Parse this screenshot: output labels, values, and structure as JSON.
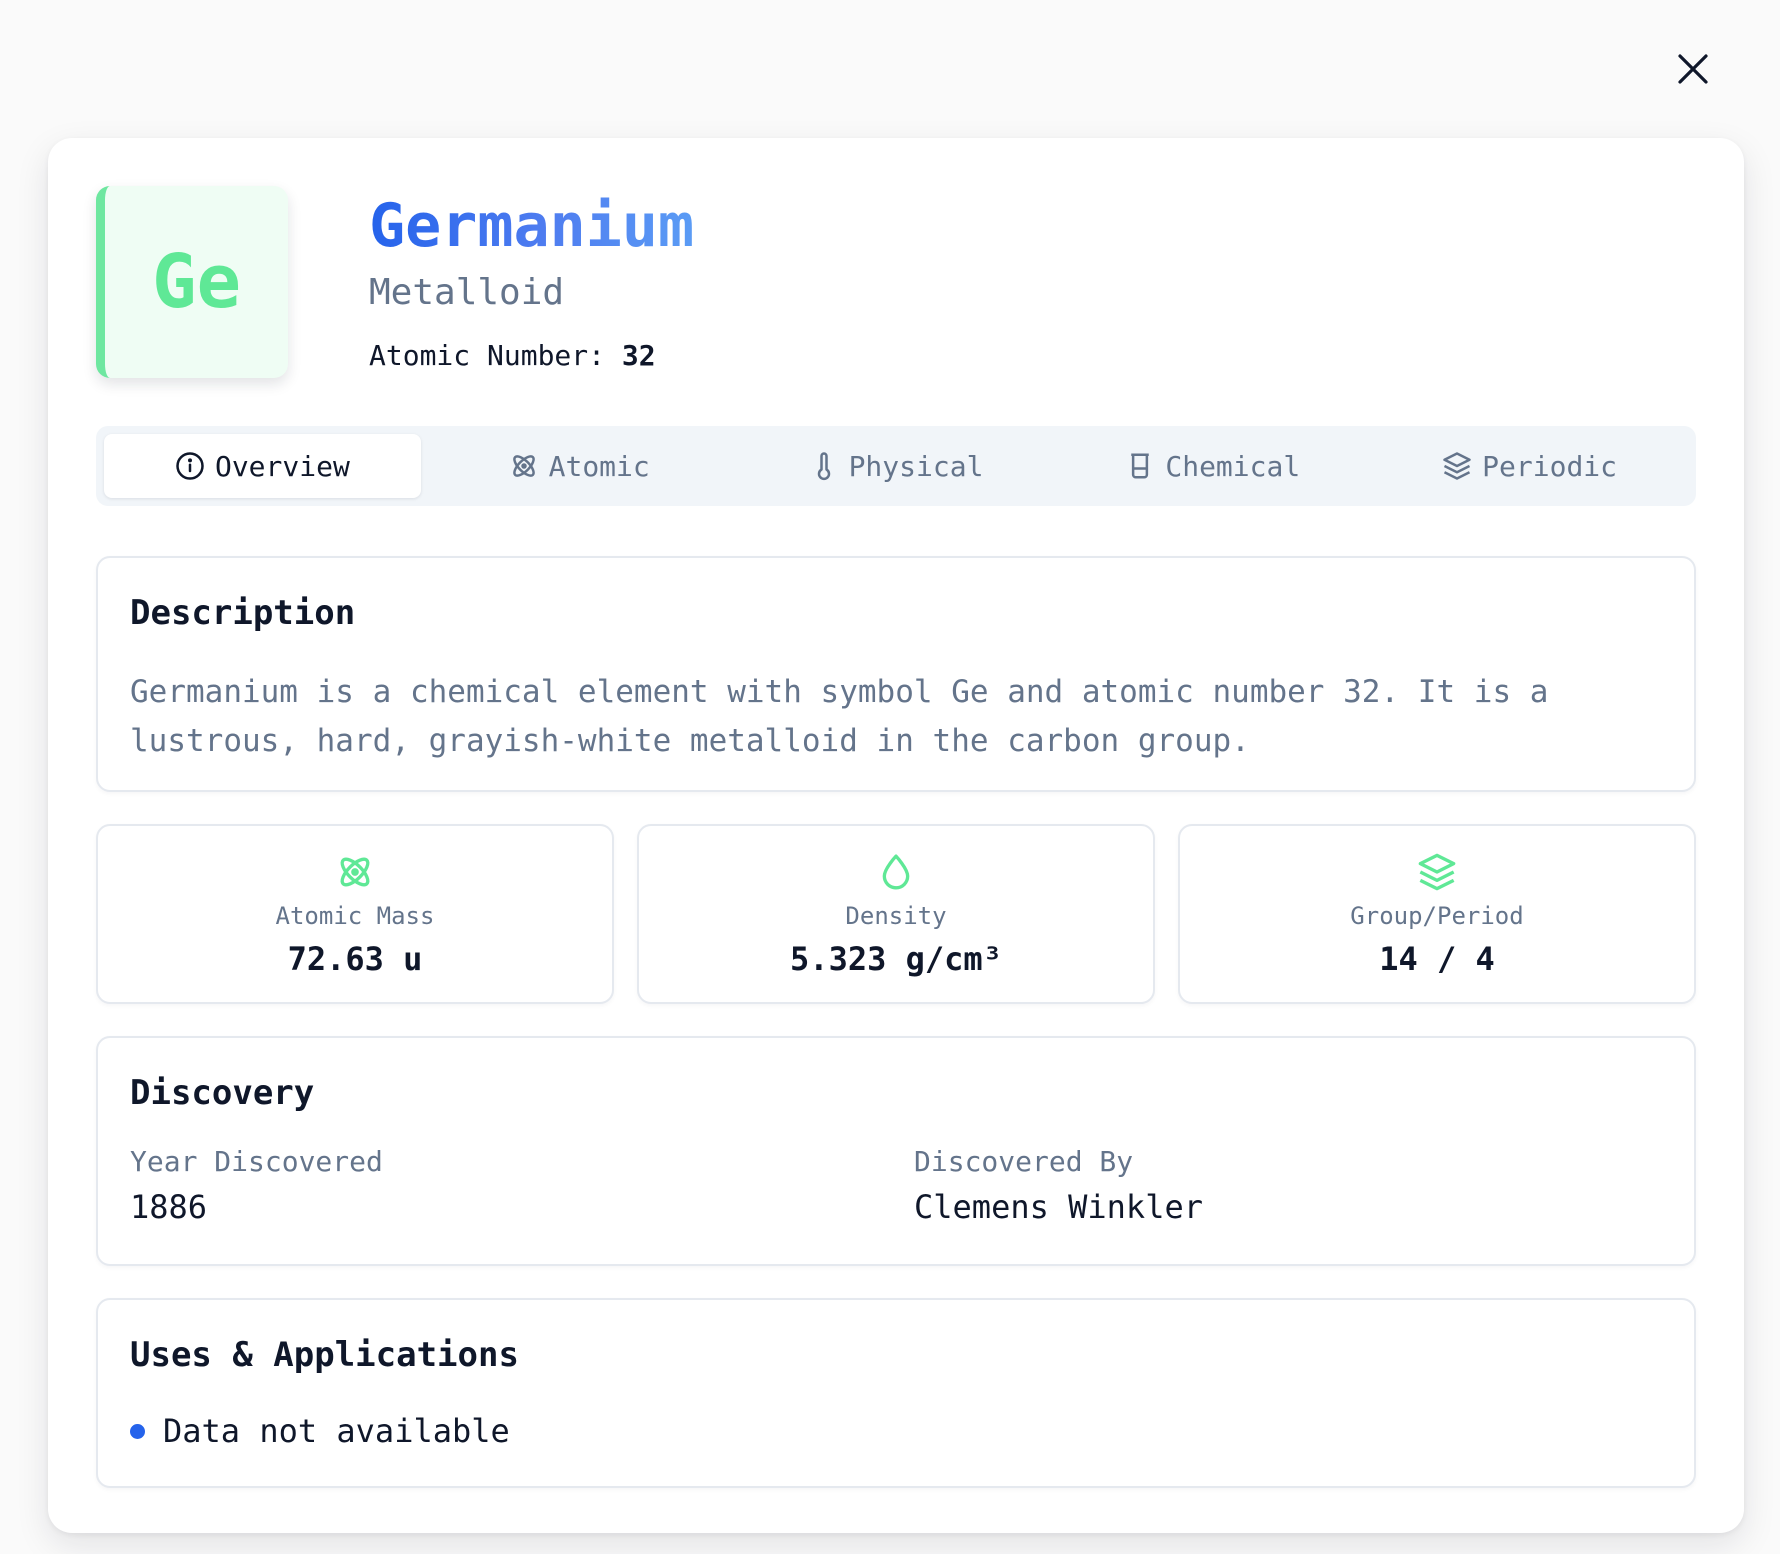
{
  "element": {
    "symbol": "Ge",
    "name": "Germanium",
    "category": "Metalloid",
    "atomic_number_label": "Atomic Number:",
    "atomic_number": "32"
  },
  "tabs": [
    {
      "label": "Overview",
      "icon": "info-icon",
      "active": true
    },
    {
      "label": "Atomic",
      "icon": "atom-icon",
      "active": false
    },
    {
      "label": "Physical",
      "icon": "thermometer-icon",
      "active": false
    },
    {
      "label": "Chemical",
      "icon": "beaker-icon",
      "active": false
    },
    {
      "label": "Periodic",
      "icon": "layers-icon",
      "active": false
    }
  ],
  "description": {
    "title": "Description",
    "text": "Germanium is a chemical element with symbol Ge and atomic number 32. It is a lustrous, hard, grayish-white metalloid in the carbon group."
  },
  "stats": [
    {
      "label": "Atomic Mass",
      "value": "72.63 u",
      "icon": "atom-icon"
    },
    {
      "label": "Density",
      "value": "5.323 g/cm³",
      "icon": "droplet-icon"
    },
    {
      "label": "Group/Period",
      "value": "14 / 4",
      "icon": "layers-icon"
    }
  ],
  "discovery": {
    "title": "Discovery",
    "year_label": "Year Discovered",
    "year": "1886",
    "by_label": "Discovered By",
    "by": "Clemens Winkler"
  },
  "uses": {
    "title": "Uses & Applications",
    "items": [
      "Data not available"
    ]
  },
  "colors": {
    "accent_green": "#5fe896",
    "accent_blue": "#2563eb",
    "muted_text": "#64748b"
  }
}
